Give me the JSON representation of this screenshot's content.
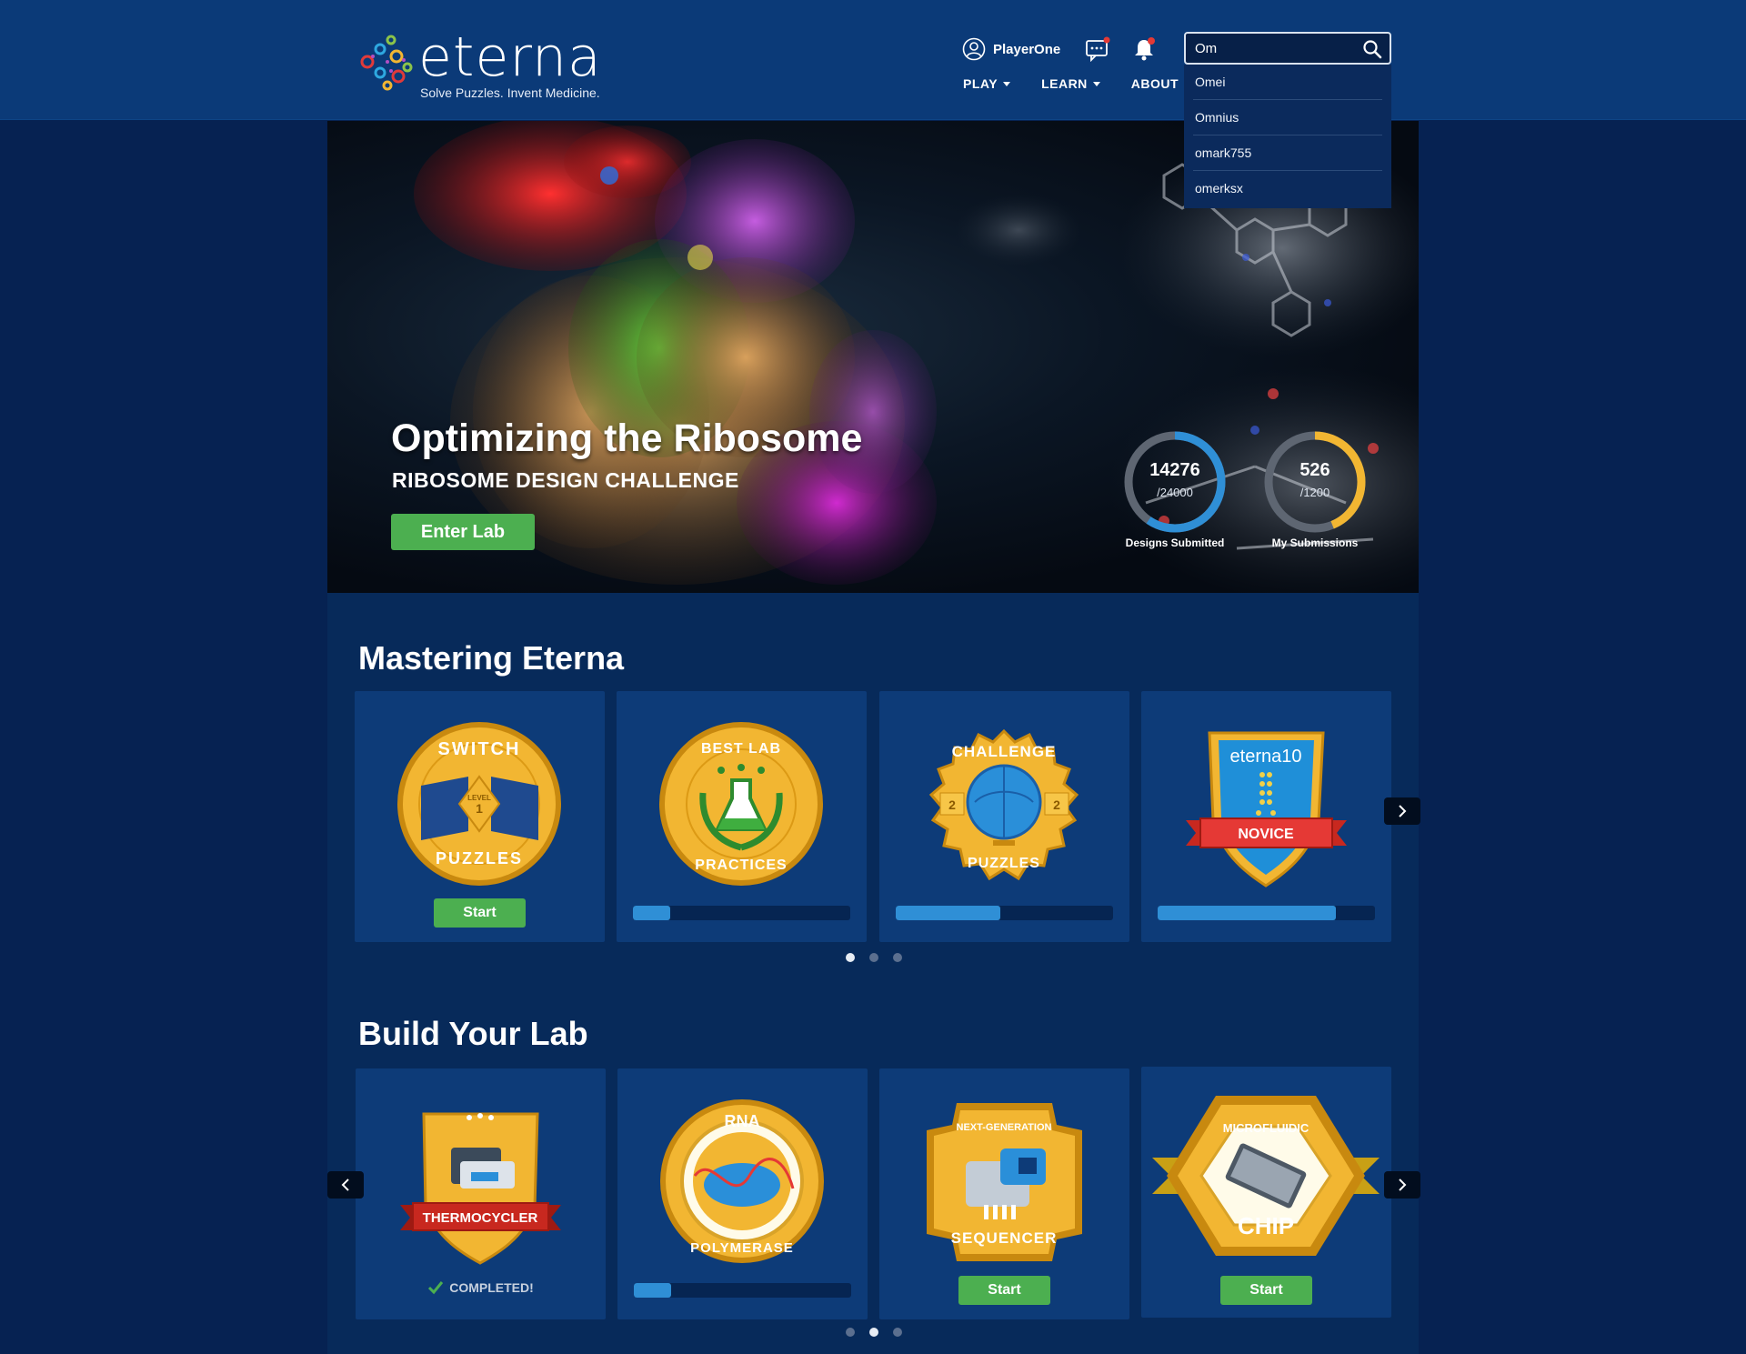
{
  "header": {
    "logo_word": "eterna",
    "tagline": "Solve Puzzles. Invent Medicine.",
    "username": "PlayerOne",
    "nav": [
      {
        "label": "PLAY"
      },
      {
        "label": "LEARN"
      },
      {
        "label": "ABOUT"
      }
    ],
    "search": {
      "value": "Om",
      "suggestions": [
        "Omei",
        "Omnius",
        "omark755",
        "omerksx"
      ]
    }
  },
  "hero": {
    "title": "Optimizing the Ribosome",
    "subtitle": "RIBOSOME DESIGN CHALLENGE",
    "button_label": "Enter Lab",
    "stats": [
      {
        "value": "14276",
        "total": "/24000",
        "label": "Designs Submitted",
        "fraction": 0.595,
        "color": "#2f8fd6"
      },
      {
        "value": "526",
        "total": "/1200",
        "label": "My Submissions",
        "fraction": 0.438,
        "color": "#f2b632"
      }
    ]
  },
  "mastering": {
    "title": "Mastering Eterna",
    "cards": [
      {
        "badge": "switch-puzzles-badge",
        "badge_text": [
          "SWITCH",
          "PUZZLES",
          "LEVEL",
          "1"
        ],
        "action": "start",
        "button_label": "Start"
      },
      {
        "badge": "best-lab-practices-badge",
        "badge_text": [
          "BEST LAB",
          "PRACTICES"
        ],
        "action": "progress",
        "progress": 0.17
      },
      {
        "badge": "challenge-puzzles-badge",
        "badge_text": [
          "CHALLENGE",
          "PUZZLES",
          "LEVEL",
          "2",
          "LEVEL",
          "2"
        ],
        "action": "progress",
        "progress": 0.48
      },
      {
        "badge": "eterna10-novice-badge",
        "badge_text": [
          "eterna10",
          "NOVICE"
        ],
        "action": "progress",
        "progress": 0.82
      }
    ],
    "active_dot": 0,
    "dot_count": 3
  },
  "build": {
    "title": "Build Your Lab",
    "cards": [
      {
        "badge": "thermocycler-badge",
        "badge_text": [
          "THERMOCYCLER"
        ],
        "action": "completed",
        "status_label": "COMPLETED!"
      },
      {
        "badge": "rna-polymerase-badge",
        "badge_text": [
          "RNA",
          "POLYMERASE"
        ],
        "action": "progress",
        "progress": 0.17
      },
      {
        "badge": "sequencer-badge",
        "badge_text": [
          "NEXT-GENERATION",
          "SEQUENCER"
        ],
        "action": "start",
        "button_label": "Start"
      },
      {
        "badge": "microfluidic-chip-badge",
        "badge_text": [
          "MICROFLUIDIC",
          "CHIP"
        ],
        "action": "start",
        "button_label": "Start"
      }
    ],
    "active_dot": 1,
    "dot_count": 3
  },
  "colors": {
    "page_bg": "#062252",
    "header_bg": "#0b3a78",
    "card_bg": "#0d3b78",
    "accent_green": "#4caf50",
    "progress_blue": "#2f8fd6",
    "gold": "#f2b632"
  }
}
